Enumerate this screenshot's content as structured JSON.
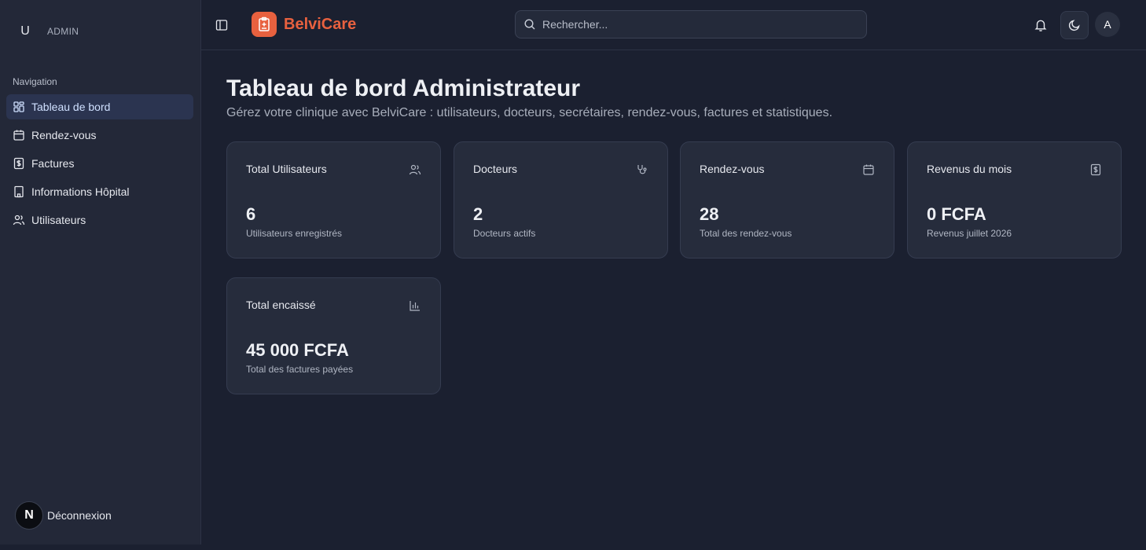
{
  "sidebar": {
    "user_initial": "U",
    "user_role": "ADMIN",
    "section_label": "Navigation",
    "items": [
      {
        "label": "Tableau de bord",
        "icon": "layout-grid-icon",
        "active": true
      },
      {
        "label": "Rendez-vous",
        "icon": "calendar-icon",
        "active": false
      },
      {
        "label": "Factures",
        "icon": "dollar-receipt-icon",
        "active": false
      },
      {
        "label": "Informations Hôpital",
        "icon": "building-icon",
        "active": false
      },
      {
        "label": "Utilisateurs",
        "icon": "users-icon",
        "active": false
      }
    ],
    "logout_badge": "N",
    "logout_label": "Déconnexion"
  },
  "header": {
    "brand_name": "BelviCare",
    "search_placeholder": "Rechercher...",
    "avatar_initial": "A"
  },
  "main": {
    "title": "Tableau de bord Administrateur",
    "subtitle": "Gérez votre clinique avec BelviCare : utilisateurs, docteurs, secrétaires, rendez-vous, factures et statistiques.",
    "cards": [
      {
        "title": "Total Utilisateurs",
        "value": "6",
        "desc": "Utilisateurs enregistrés",
        "icon": "users-icon"
      },
      {
        "title": "Docteurs",
        "value": "2",
        "desc": "Docteurs actifs",
        "icon": "stethoscope-icon"
      },
      {
        "title": "Rendez-vous",
        "value": "28",
        "desc": "Total des rendez-vous",
        "icon": "calendar-icon"
      },
      {
        "title": "Revenus du mois",
        "value": "0 FCFA",
        "desc": "Revenus juillet 2026",
        "icon": "dollar-receipt-icon"
      },
      {
        "title": "Total encaissé",
        "value": "45 000 FCFA",
        "desc": "Total des factures payées",
        "icon": "bar-chart-icon"
      }
    ]
  },
  "colors": {
    "brand": "#e8613f",
    "background": "#1b2030",
    "sidebar": "#232838",
    "card": "#262c3c",
    "active_item": "#2b3450"
  }
}
